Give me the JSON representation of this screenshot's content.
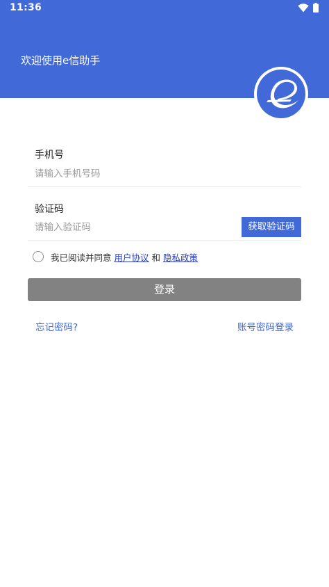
{
  "status_bar": {
    "time": "11:36"
  },
  "header": {
    "welcome": "欢迎使用e信助手"
  },
  "form": {
    "phone": {
      "label": "手机号",
      "placeholder": "请输入手机号码"
    },
    "code": {
      "label": "验证码",
      "placeholder": "请输入验证码",
      "button": "获取验证码"
    },
    "agreement": {
      "prefix": "我已阅读并同意 ",
      "user_agreement": "用户协议",
      "and": " 和 ",
      "privacy_policy": "隐私政策"
    },
    "login_button": "登录"
  },
  "links": {
    "forgot_password": "忘记密码?",
    "password_login": "账号密码登录"
  },
  "colors": {
    "primary": "#4169d8",
    "login_disabled": "#828282",
    "link": "#2a3ec4"
  }
}
